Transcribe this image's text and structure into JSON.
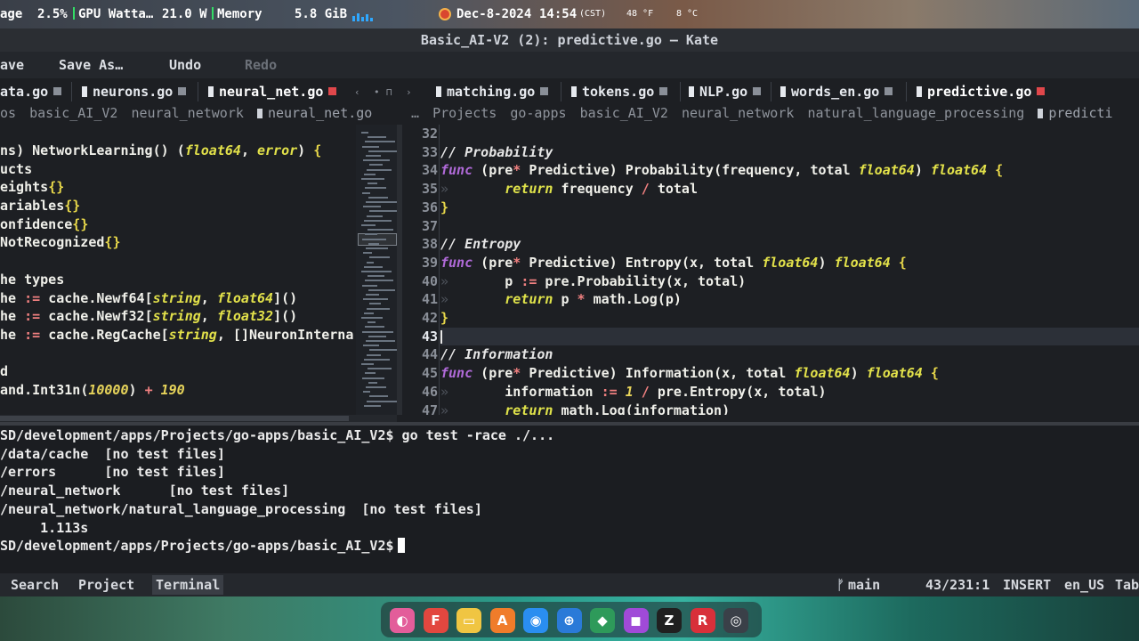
{
  "system_panel": {
    "usage_label": "age",
    "usage_value": "2.5%",
    "gpu_label": "GPU Watta…",
    "gpu_value": "21.0 W",
    "memory_label": "Memory",
    "memory_value": "5.8 GiB",
    "date": "Dec-8-2024",
    "time": "14:54",
    "timezone": "(CST)",
    "temp_outside": "48 °F",
    "temp_sensor": "8 °C"
  },
  "window": {
    "title": "Basic_AI-V2 (2): predictive.go — Kate"
  },
  "toolbar": {
    "save_label": "ave",
    "save_as_label": "Save As…",
    "undo_label": "Undo",
    "redo_label": "Redo"
  },
  "tabs_left": [
    {
      "label": "ata.go"
    },
    {
      "label": "neurons.go"
    },
    {
      "label": "neural_net.go",
      "active": true
    }
  ],
  "tabs_right": [
    {
      "label": "matching.go"
    },
    {
      "label": "tokens.go"
    },
    {
      "label": "NLP.go"
    },
    {
      "label": "words_en.go"
    },
    {
      "label": "predictive.go",
      "active": true
    }
  ],
  "breadcrumbs_left": [
    "os",
    "basic_AI_V2",
    "neural_network",
    "neural_net.go"
  ],
  "breadcrumbs_right": [
    "…",
    "Projects",
    "go-apps",
    "basic_AI_V2",
    "neural_network",
    "natural_language_processing",
    "predicti"
  ],
  "left_code": [
    "ns) NetworkLearning() (float64, error) {",
    "ucts",
    "eights{}",
    "ariables{}",
    "onfidence{}",
    "NotRecognized{}",
    "",
    "he types",
    "he := cache.Newf64[string, float64]()",
    "he := cache.Newf32[string, float32]()",
    "he := cache.RegCache[string, []NeuronInterna",
    "",
    "d",
    "and.Int31n(10000) + 190"
  ],
  "line_numbers": [
    "32",
    "33",
    "34",
    "35",
    "36",
    "37",
    "38",
    "39",
    "40",
    "41",
    "42",
    "43",
    "44",
    "45",
    "46",
    "47"
  ],
  "right_code": [
    "",
    "// Probability",
    "func (pre* Predictive) Probability(frequency, total float64) float64 {",
    "\treturn frequency / total",
    "}",
    "",
    "// Entropy",
    "func (pre* Predictive) Entropy(x, total float64) float64 {",
    "\tp := pre.Probability(x, total)",
    "\treturn p * math.Log(p)",
    "}",
    "",
    "// Information",
    "func (pre* Predictive) Information(x, total float64) float64 {",
    "\tinformation := 1 / pre.Entropy(x, total)",
    "\treturn math.Log(information)"
  ],
  "terminal": {
    "prompt_path": "SD/development/apps/Projects/go-apps/basic_AI_V2$",
    "command": "go test -race ./...",
    "output": [
      "/data/cache  [no test files]",
      "/errors      [no test files]",
      "/neural_network      [no test files]",
      "/neural_network/natural_language_processing  [no test files]",
      "     1.113s"
    ]
  },
  "statusbar": {
    "search": "Search",
    "project": "Project",
    "terminal": "Terminal",
    "branch": "main",
    "position": "43/231:1",
    "mode": "INSERT",
    "language": "en_US",
    "tab_label": "Tab"
  },
  "dock_apps": [
    {
      "name": "color-picker-app",
      "glyph": "◐",
      "color": "#e35d9a"
    },
    {
      "name": "framer-app",
      "glyph": "F",
      "color": "#e2473f"
    },
    {
      "name": "files-app",
      "glyph": "▭",
      "color": "#f0c542"
    },
    {
      "name": "appimage-app",
      "glyph": "A",
      "color": "#f07c2a"
    },
    {
      "name": "browser-app",
      "glyph": "◉",
      "color": "#2a8ef0"
    },
    {
      "name": "network-app",
      "glyph": "⊕",
      "color": "#2a7ad8"
    },
    {
      "name": "archive-app",
      "glyph": "◆",
      "color": "#2e9a5a"
    },
    {
      "name": "media-app",
      "glyph": "◼",
      "color": "#a04ad8"
    },
    {
      "name": "zed-app",
      "glyph": "Z",
      "color": "#202020"
    },
    {
      "name": "r-app",
      "glyph": "R",
      "color": "#d8303a"
    },
    {
      "name": "gamepad-app",
      "glyph": "◎",
      "color": "#3a4048"
    }
  ]
}
